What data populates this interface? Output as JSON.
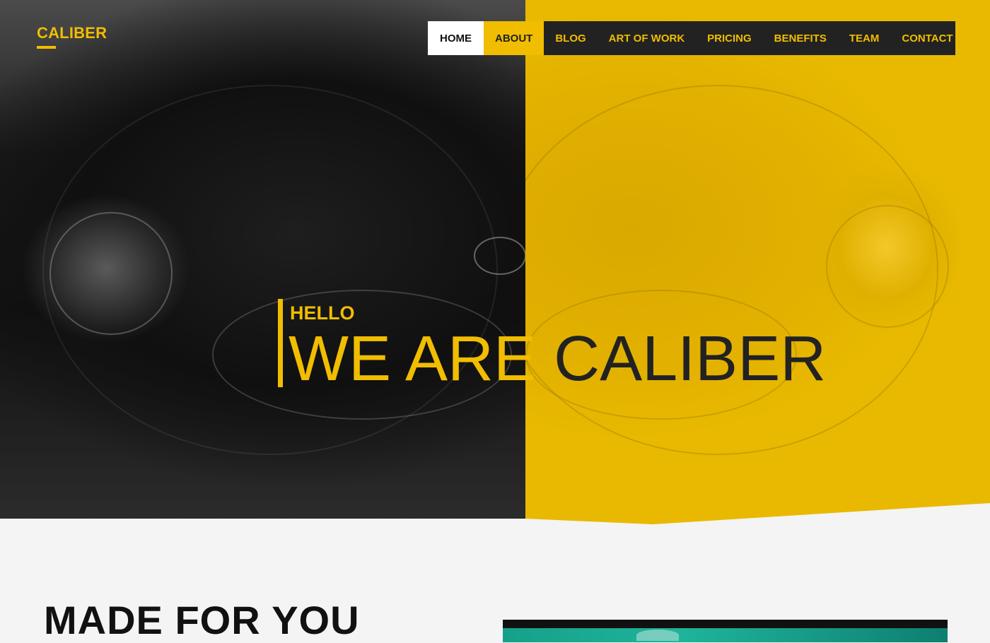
{
  "brand": {
    "name": "CALIBER",
    "accent": "#f1bd00",
    "dark": "#222222"
  },
  "nav": {
    "items": [
      {
        "label": "HOME",
        "state": "active"
      },
      {
        "label": "ABOUT",
        "state": "hover"
      },
      {
        "label": "BLOG"
      },
      {
        "label": "ART OF WORK"
      },
      {
        "label": "PRICING"
      },
      {
        "label": "BENEFITS"
      },
      {
        "label": "TEAM"
      },
      {
        "label": "CONTACT"
      }
    ]
  },
  "hero": {
    "greeting": "HELLO",
    "headline_part1": "WE ARE",
    "headline_part2": "CALIBER"
  },
  "section": {
    "title": "MADE FOR YOU"
  }
}
